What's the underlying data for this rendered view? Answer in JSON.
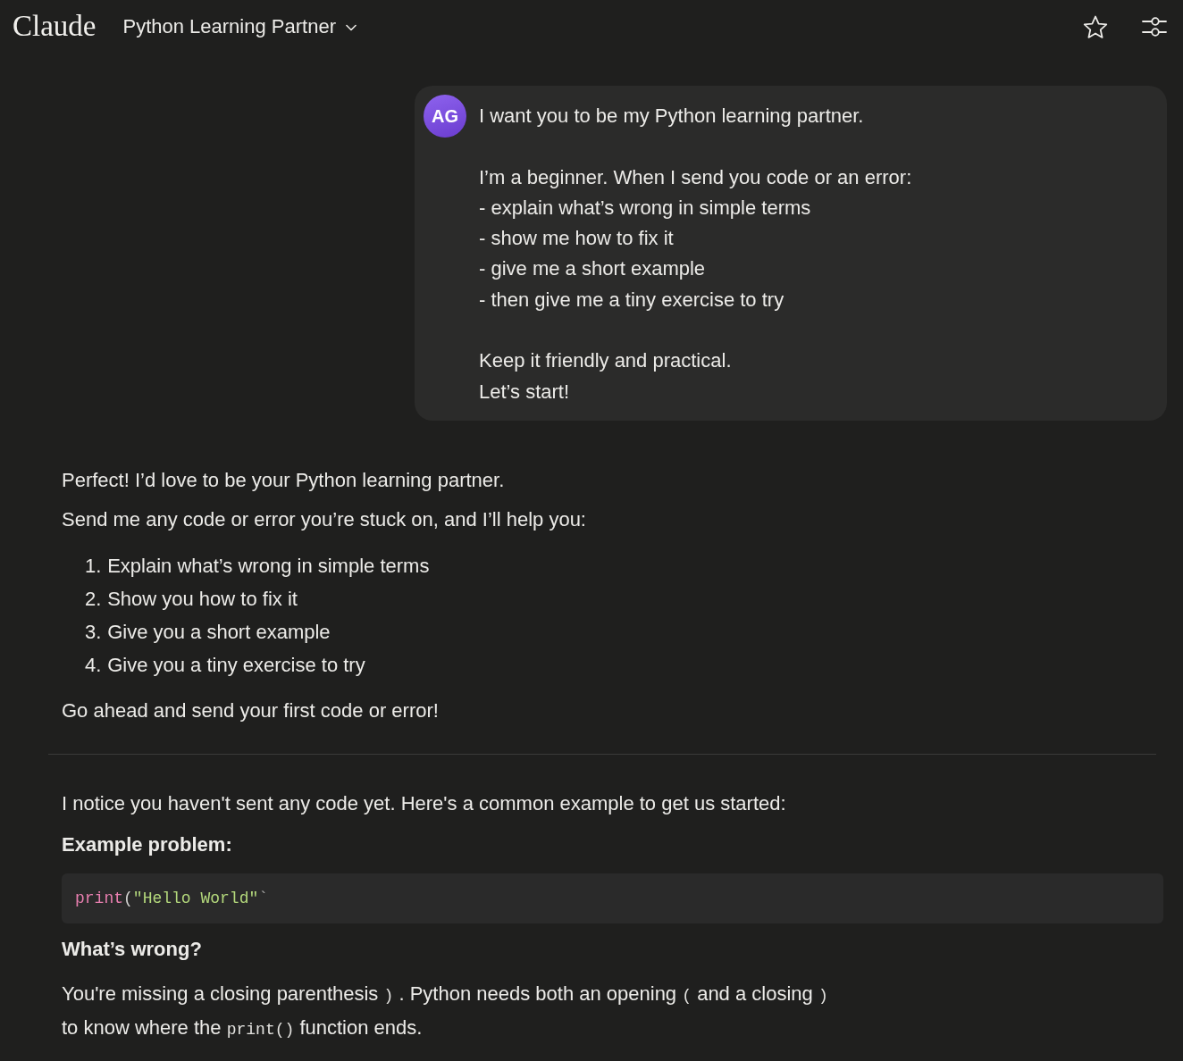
{
  "header": {
    "logo": "Claude",
    "chat_title": "Python Learning Partner"
  },
  "user_message": {
    "avatar_initials": "AG",
    "paragraphs": [
      [
        "I want you to be my Python learning partner."
      ],
      [
        "I’m a beginner. When I send you code or an error:",
        "- explain what’s wrong in simple terms",
        "- show me how to fix it",
        "- give me a short example",
        "- then give me a tiny exercise to try"
      ],
      [
        "Keep it friendly and practical.",
        "Let’s start!"
      ]
    ]
  },
  "assistant_turns": [
    {
      "blocks": [
        {
          "kind": "paragraph",
          "text": "Perfect! I’d love to be your Python learning partner."
        },
        {
          "kind": "paragraph",
          "text": "Send me any code or error you’re stuck on, and I’ll help you:"
        },
        {
          "kind": "ordered_list",
          "items": [
            {
              "number": "1.",
              "text": "Explain what’s wrong in simple terms"
            },
            {
              "number": "2.",
              "text": "Show you how to fix it"
            },
            {
              "number": "3.",
              "text": "Give you a short example"
            },
            {
              "number": "4.",
              "text": "Give you a tiny exercise to try"
            }
          ]
        },
        {
          "kind": "paragraph",
          "text": "Go ahead and send your first code or error!"
        }
      ]
    },
    {
      "blocks": [
        {
          "kind": "paragraph",
          "text": "I notice you haven't sent any code yet. Here's a common example to get us started:"
        },
        {
          "kind": "heading",
          "text": "Example problem:"
        },
        {
          "kind": "code",
          "tokens": [
            {
              "kind": "function",
              "text": "print"
            },
            {
              "kind": "punctuation",
              "text": "("
            },
            {
              "kind": "string",
              "text": "\"Hello World\""
            },
            {
              "kind": "stray",
              "text": "`"
            }
          ]
        },
        {
          "kind": "heading",
          "text": "What’s wrong?"
        },
        {
          "kind": "rich_paragraph",
          "lines": [
            [
              {
                "kind": "text",
                "text": "You're missing a closing parenthesis "
              },
              {
                "kind": "code",
                "text": ")"
              },
              {
                "kind": "text",
                "text": " . Python needs both an opening "
              },
              {
                "kind": "code",
                "text": "("
              },
              {
                "kind": "text",
                "text": " and a closing "
              },
              {
                "kind": "code",
                "text": ")"
              }
            ],
            [
              {
                "kind": "text",
                "text": "to know where the "
              },
              {
                "kind": "code",
                "text": "print()"
              },
              {
                "kind": "text",
                "text": " function ends."
              }
            ]
          ]
        }
      ]
    }
  ]
}
